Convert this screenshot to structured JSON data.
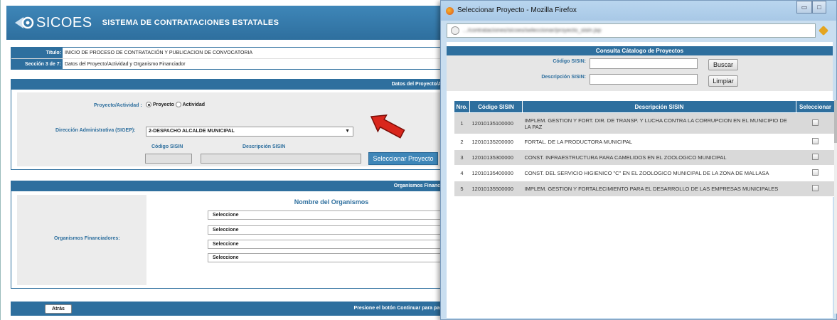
{
  "app": {
    "logo_text": "SICOES",
    "header_title": "SISTEMA DE CONTRATACIONES ESTATALES"
  },
  "info": {
    "titulo_label": "Título:",
    "titulo_value": "INICIO DE PROCESO DE CONTRATACIÓN Y PUBLICACION DE CONVOCATORIA",
    "seccion_label": "Sección 3 de 7:",
    "seccion_value": "Datos del Proyecto/Actividad y Organismo Financiador"
  },
  "section1": {
    "bar_title": "Datos del Proyecto/A",
    "tipo_label": "Proyecto/Actividad :",
    "radio_proyecto": "Proyecto",
    "radio_actividad": "Actividad",
    "direccion_label": "Dirección Administrativa (SIGEP):",
    "direccion_value": "2-DESPACHO ALCALDE MUNICIPAL",
    "codigo_label": "Código SISIN",
    "descripcion_label": "Descripción SISIN",
    "select_btn": "Seleccionar Proyecto"
  },
  "section2": {
    "bar_title": "Organismos Financi",
    "left_label": "Organismos Financiadores:",
    "column_title": "Nombre del Organismos",
    "selects": [
      "Seleccione",
      "Seleccione",
      "Seleccione",
      "Seleccione"
    ]
  },
  "footer": {
    "back_btn": "Atrás",
    "hint": "Presione el botón Continuar para pas"
  },
  "popup": {
    "window_title": "Seleccionar Proyecto - Mozilla Firefox",
    "url": ".../contrataciones/sicoes/seleccionar/proyecto_sisin.jsp",
    "catalog_title": "Consulta Cátalogo de Proyectos",
    "codigo_label": "Código SISIN:",
    "descripcion_label": "Descripción SISIN:",
    "buscar_btn": "Buscar",
    "limpiar_btn": "Limpiar",
    "columns": [
      "Nro.",
      "Código SISIN",
      "Descripción SISIN",
      "Seleccionar"
    ],
    "rows": [
      {
        "nro": "1",
        "codigo": "12010135100000",
        "descripcion": "IMPLEM. GESTION Y FORT. DIR. DE TRANSP. Y LUCHA CONTRA LA CORRUPCION EN EL MUNICIPIO DE LA PAZ"
      },
      {
        "nro": "2",
        "codigo": "12010135200000",
        "descripcion": "FORTAL. DE LA PRODUCTORA MUNICIPAL"
      },
      {
        "nro": "3",
        "codigo": "12010135300000",
        "descripcion": "CONST. INFRAESTRUCTURA PARA CAMELIDOS EN EL ZOOLOGICO MUNICIPAL"
      },
      {
        "nro": "4",
        "codigo": "12010135400000",
        "descripcion": "CONST. DEL SERVICIO HIGIENICO \"C\" EN EL ZOOLOGICO MUNICIPAL DE LA ZONA DE MALLASA"
      },
      {
        "nro": "5",
        "codigo": "12010135500000",
        "descripcion": "IMPLEM. GESTION Y FORTALECIMIENTO PARA EL DESARROLLO DE LAS EMPRESAS MUNICIPALES"
      }
    ]
  },
  "colors": {
    "primary_blue": "#2e6f9e",
    "accent_red": "#d9261c"
  }
}
